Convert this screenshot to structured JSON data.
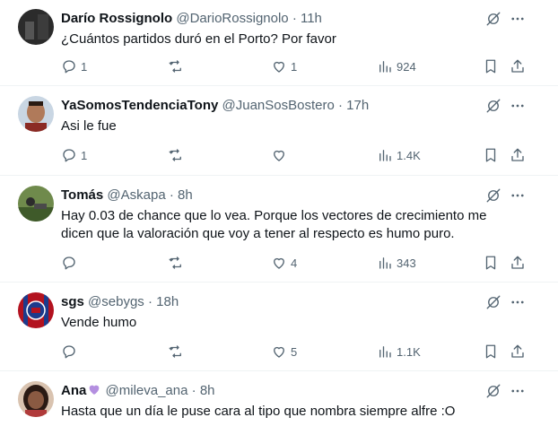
{
  "tweets": [
    {
      "name": "Darío Rossignolo",
      "handle": "@DarioRossignolo",
      "separator": "·",
      "time": "11h",
      "text": "¿Cuántos partidos duró en el Porto? Por favor",
      "replies": "1",
      "retweets": "",
      "likes": "1",
      "views": "924",
      "avatar_color": "#2b2b2b"
    },
    {
      "name": "YaSomosTendenciaTony",
      "handle": "@JuanSosBostero",
      "separator": "·",
      "time": "17h",
      "text": "Asi le fue",
      "replies": "1",
      "retweets": "",
      "likes": "",
      "views": "1.4K",
      "avatar_color": "#b07a5a"
    },
    {
      "name": "Tomás",
      "handle": "@Askapa",
      "separator": "·",
      "time": "8h",
      "text": "Hay 0.03 de chance que lo vea. Porque los vectores de crecimiento me dicen que la valoración que voy a tener al respecto es humo puro.",
      "replies": "",
      "retweets": "",
      "likes": "4",
      "views": "343",
      "avatar_color": "#4a6b3a"
    },
    {
      "name": "sgs",
      "handle": "@sebygs",
      "separator": "·",
      "time": "18h",
      "text": "Vende humo",
      "replies": "",
      "retweets": "",
      "likes": "5",
      "views": "1.1K",
      "avatar_color": "#b3121f"
    },
    {
      "name": "Ana",
      "handle": "@mileva_ana",
      "separator": "·",
      "time": "8h",
      "text": "Hasta que un día le puse cara al tipo que nombra siempre alfre :O",
      "replies": "",
      "retweets": "",
      "likes": "",
      "views": "",
      "avatar_color": "#5a3b2e",
      "badge_color": "#b48fe0"
    }
  ]
}
